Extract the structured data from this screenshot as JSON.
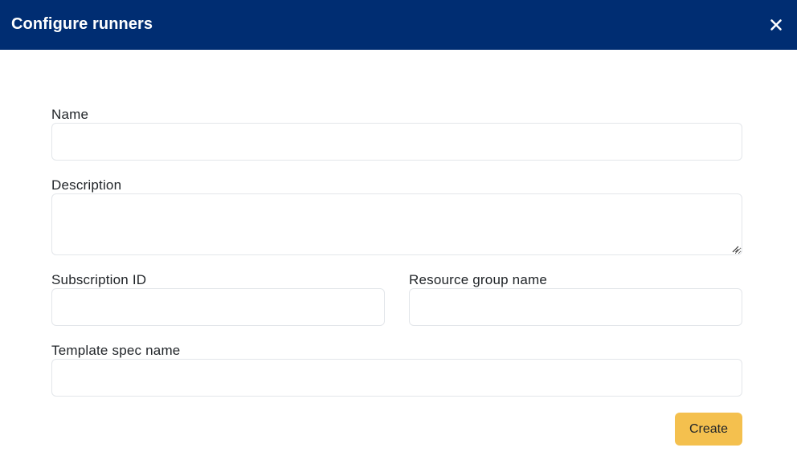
{
  "dialog": {
    "title": "Configure runners",
    "close_icon": "close-icon"
  },
  "form": {
    "name": {
      "label": "Name",
      "value": "",
      "placeholder": ""
    },
    "description": {
      "label": "Description",
      "value": "",
      "placeholder": ""
    },
    "subscription_id": {
      "label": "Subscription ID",
      "value": "",
      "placeholder": ""
    },
    "resource_group_name": {
      "label": "Resource group name",
      "value": "",
      "placeholder": ""
    },
    "template_spec_name": {
      "label": "Template spec name",
      "value": "",
      "placeholder": ""
    },
    "create_label": "Create"
  },
  "colors": {
    "header_bg": "#002d72",
    "header_text": "#ffffff",
    "primary_button": "#f4c04e",
    "input_border": "#e3e6ea"
  }
}
